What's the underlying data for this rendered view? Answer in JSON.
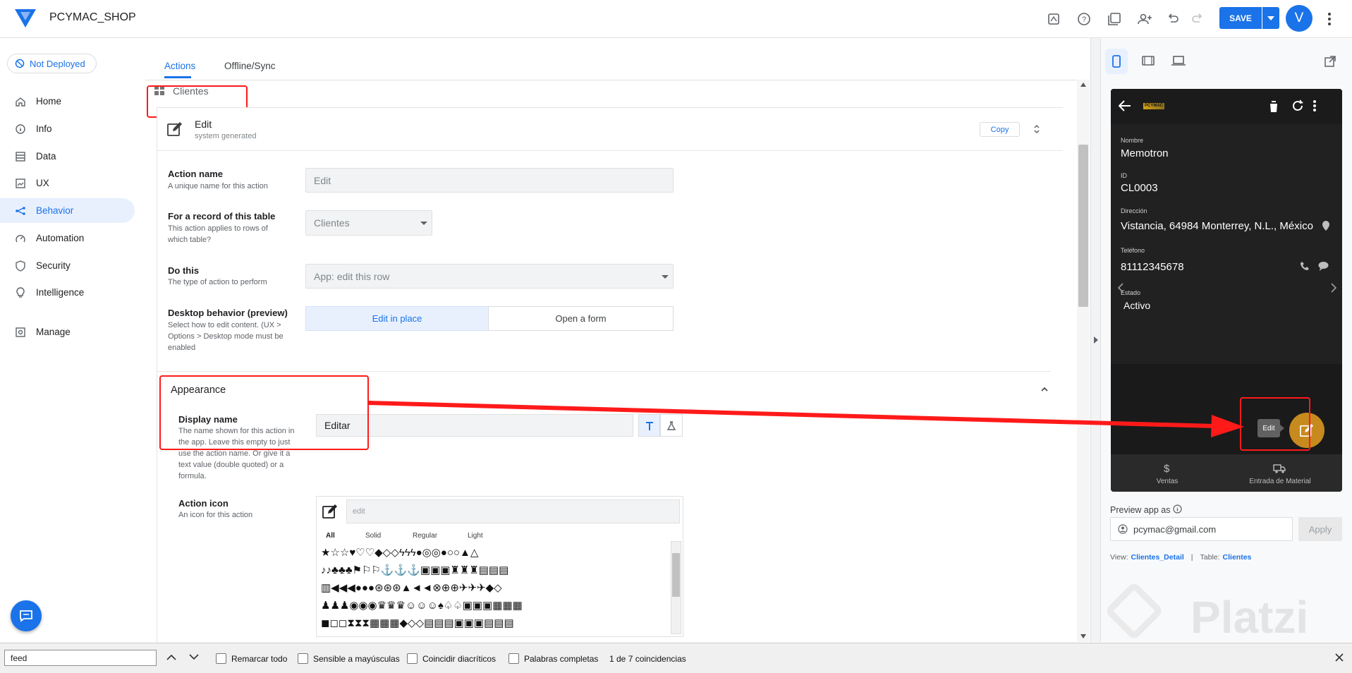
{
  "app": {
    "name": "PCYMAC_SHOP",
    "save_label": "SAVE",
    "avatar_letter": "V"
  },
  "sidebar": {
    "status": "Not Deployed",
    "items": [
      {
        "label": "Home",
        "icon": "home-icon"
      },
      {
        "label": "Info",
        "icon": "info-icon"
      },
      {
        "label": "Data",
        "icon": "data-icon"
      },
      {
        "label": "UX",
        "icon": "ux-icon"
      },
      {
        "label": "Behavior",
        "icon": "behavior-icon",
        "active": true
      },
      {
        "label": "Automation",
        "icon": "automation-icon"
      },
      {
        "label": "Security",
        "icon": "security-icon"
      },
      {
        "label": "Intelligence",
        "icon": "lightbulb-icon"
      },
      {
        "label": "Manage",
        "icon": "manage-icon"
      }
    ]
  },
  "tabs": [
    "Actions",
    "Offline/Sync"
  ],
  "table_header": "Clientes",
  "action": {
    "title": "Edit",
    "subtitle": "system generated",
    "copy_label": "Copy",
    "name_label": "Action name",
    "name_desc": "A unique name for this action",
    "name_value": "Edit",
    "table_label": "For a record of this table",
    "table_desc": "This action applies to rows of which table?",
    "table_value": "Clientes",
    "do_label": "Do this",
    "do_desc": "The type of action to perform",
    "do_value": "App: edit this row",
    "desktop_label": "Desktop behavior (preview)",
    "desktop_desc": "Select how to edit content. (UX > Options > Desktop mode must be enabled",
    "desktop_opt1": "Edit in place",
    "desktop_opt2": "Open a form"
  },
  "appearance": {
    "header": "Appearance",
    "display_label": "Display name",
    "display_desc": "The name shown for this action in the app. Leave this empty to just use the action name. Or give it a text value (double quoted) or a formula.",
    "display_value": "Editar",
    "icon_label": "Action icon",
    "icon_desc": "An icon for this action",
    "icon_search": "edit",
    "icon_tabs": [
      "All",
      "Solid",
      "Regular",
      "Light"
    ],
    "icon_rows": [
      "★☆☆♥♡♡◆◇◇ϟϟϟ●◎◎●○○▲△",
      "♪♪♣♣♣⚑⚐⚐⚓⚓⚓▣▣▣♜♜♜▤▤▤",
      "▥◀◀◀●●●⊛⊛⊛▲◄◄⊗⊕⊕✈✈✈◆◇",
      "♟♟♟◉◉◉♛♛♛☺☺☺♠♤♤▣▣▣▦▦▦",
      "◼◻◻⧗⧗⧗▦▦▦◆◇◇▤▤▤▣▣▣▤▤▤"
    ]
  },
  "preview": {
    "fields": [
      {
        "label": "Nombre",
        "value": "Memotron"
      },
      {
        "label": "ID",
        "value": "CL0003"
      },
      {
        "label": "Dirección",
        "value": "Vistancia, 64984 Monterrey, N.L., México"
      },
      {
        "label": "Teléfono",
        "value": "81112345678"
      },
      {
        "label": "Estado",
        "value": "Activo"
      }
    ],
    "brand": "PCYMAC",
    "edit_tooltip": "Edit",
    "bottom_nav": [
      "Ventas",
      "Entrada de Material"
    ],
    "preview_as_label": "Preview app as",
    "email": "pcymac@gmail.com",
    "apply_label": "Apply",
    "view_label": "View:",
    "view_value": "Clientes_Detail",
    "table_label": "Table:",
    "table_value": "Clientes",
    "watermark": "Platzi"
  },
  "findbar": {
    "query": "feed",
    "options": [
      "Remarcar todo",
      "Sensible a mayúsculas",
      "Coincidir diacríticos",
      "Palabras completas"
    ],
    "result": "1 de 7 coincidencias"
  },
  "colors": {
    "accent": "#1a73e8",
    "highlight": "#ff1a1a",
    "fab": "#c78a1f"
  }
}
